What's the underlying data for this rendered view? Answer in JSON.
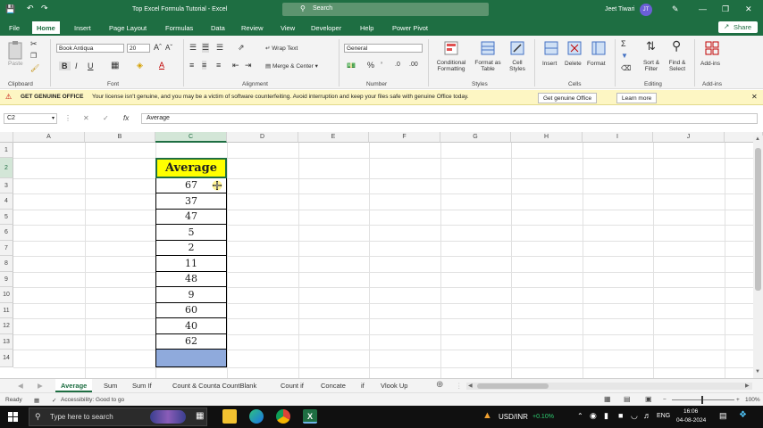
{
  "window": {
    "title": "Top Excel Formula Tutorial - Excel",
    "search_placeholder": "Search",
    "user_name": "Jeet Tiwari",
    "user_initials": "JT"
  },
  "menu": {
    "tabs": [
      "File",
      "Home",
      "Insert",
      "Page Layout",
      "Formulas",
      "Data",
      "Review",
      "View",
      "Developer",
      "Help",
      "Power Pivot"
    ],
    "active": "Home",
    "share_label": "Share"
  },
  "ribbon": {
    "font_name": "Book Antiqua",
    "font_size": "20",
    "number_format": "General",
    "clipboard": {
      "paste": "Paste"
    },
    "wrap_text": "Wrap Text",
    "merge_center": "Merge & Center",
    "buttons": {
      "conditional_formatting": [
        "Conditional",
        "Formatting"
      ],
      "format_as_table": [
        "Format as",
        "Table"
      ],
      "cell_styles": [
        "Cell",
        "Styles"
      ],
      "insert": "Insert",
      "delete": "Delete",
      "format": "Format",
      "sort_filter": [
        "Sort &",
        "Filter"
      ],
      "find_select": [
        "Find &",
        "Select"
      ],
      "addins": "Add-ins"
    },
    "groups": [
      "Clipboard",
      "Font",
      "Alignment",
      "Number",
      "Styles",
      "Cells",
      "Editing",
      "Add-ins"
    ]
  },
  "warning": {
    "title": "GET GENUINE OFFICE",
    "message": "Your license isn't genuine, and you may be a victim of software counterfeiting. Avoid interruption and keep your files safe with genuine Office today.",
    "btn_genuine": "Get genuine Office",
    "btn_learn": "Learn more"
  },
  "formula_bar": {
    "name_box": "C2",
    "cancel": "✕",
    "enter": "✓",
    "fx": "fx",
    "content": "Average"
  },
  "grid": {
    "columns": [
      "A",
      "B",
      "C",
      "D",
      "E",
      "F",
      "G",
      "H",
      "I",
      "J"
    ],
    "rows": [
      "1",
      "2",
      "3",
      "4",
      "5",
      "6",
      "7",
      "8",
      "9",
      "10",
      "11",
      "12",
      "13",
      "14"
    ],
    "header_cell": "Average",
    "values": [
      "67",
      "37",
      "47",
      "5",
      "2",
      "11",
      "48",
      "9",
      "60",
      "40",
      "62"
    ]
  },
  "sheets": {
    "tabs": [
      "Average",
      "Sum",
      "Sum If",
      "Count & Counta CountBlank",
      "Count if",
      "Concate",
      "if",
      "Vlook Up"
    ],
    "active": "Average"
  },
  "status": {
    "ready": "Ready",
    "accessibility": "Accessibility: Good to go",
    "zoom": "100%"
  },
  "taskbar": {
    "search_placeholder": "Type here to search",
    "ticker": "USD/INR",
    "ticker_change": "+0.10%",
    "language": "ENG",
    "time": "16:06",
    "date": "04-08-2024"
  },
  "colors": {
    "excel_green": "#1e6e42",
    "header_yellow": "#ffff00",
    "selection_blue": "#8faadc"
  }
}
